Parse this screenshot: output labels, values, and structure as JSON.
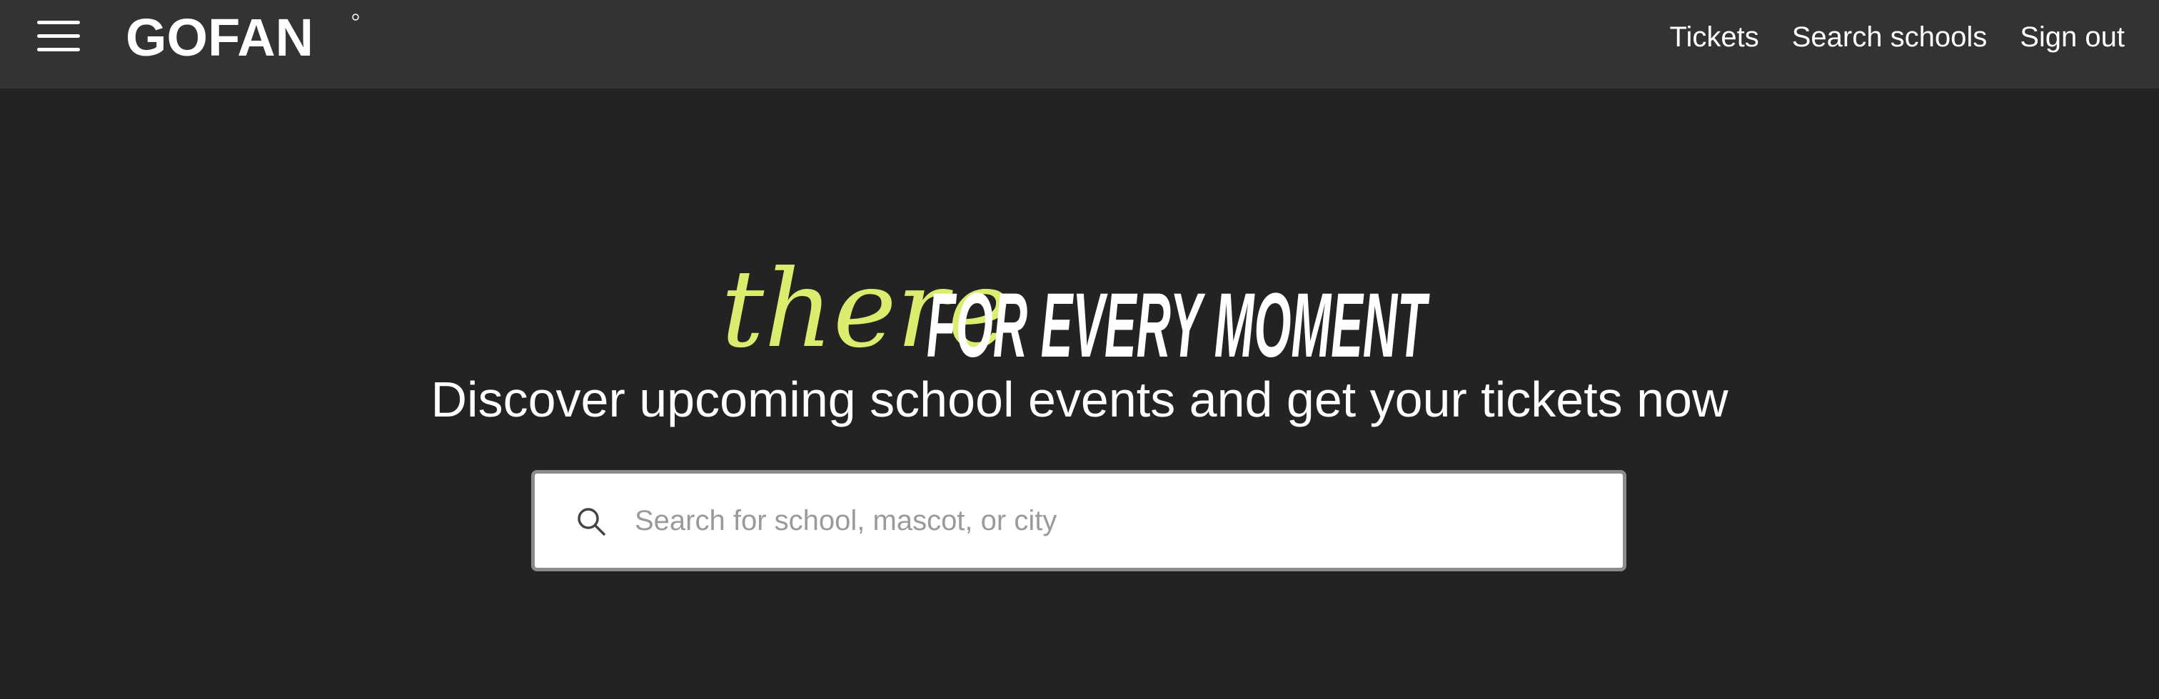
{
  "header": {
    "logo_text": "GOFAN",
    "nav": [
      {
        "label": "Tickets"
      },
      {
        "label": "Search schools"
      },
      {
        "label": "Sign out"
      }
    ]
  },
  "hero": {
    "tagline_script": "there",
    "tagline_block": "FOR EVERY MOMENT",
    "headline": "Discover upcoming school events and get your tickets now"
  },
  "search": {
    "placeholder": "Search for school, mascot, or city",
    "value": ""
  },
  "colors": {
    "page_background": "#232323",
    "topbar_background": "#333333",
    "accent": "#dcec6e",
    "text": "#ffffff"
  },
  "icons": {
    "menu": "hamburger-icon",
    "search": "search-icon"
  }
}
